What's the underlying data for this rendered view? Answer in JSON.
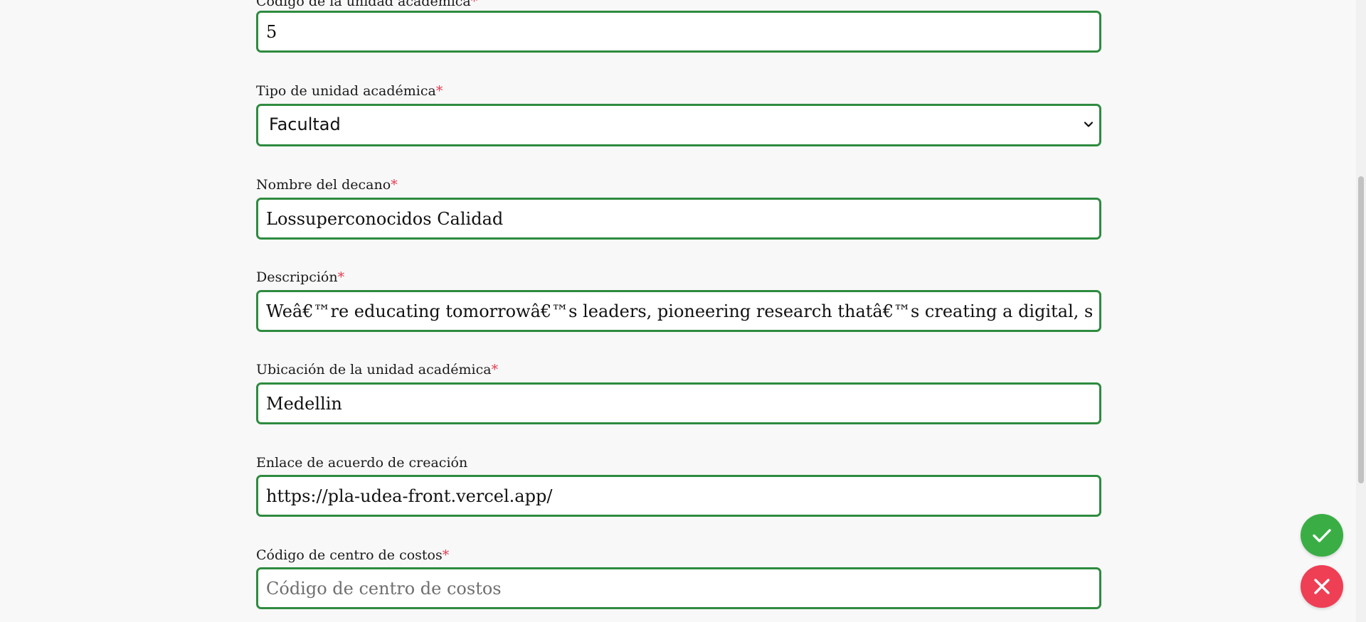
{
  "form": {
    "fields": [
      {
        "label": "Código de la unidad académica",
        "required": true,
        "type": "text",
        "value": "5",
        "placeholder": ""
      },
      {
        "label": "Tipo de unidad académica",
        "required": true,
        "type": "select",
        "value": "Facultad",
        "placeholder": ""
      },
      {
        "label": "Nombre del decano",
        "required": true,
        "type": "text",
        "value": "Lossuperconocidos Calidad",
        "placeholder": ""
      },
      {
        "label": "Descripción",
        "required": true,
        "type": "text",
        "value": "Weâ€™re educating tomorrowâ€™s leaders, pioneering research thatâ€™s creating a digital, sustainable future",
        "placeholder": ""
      },
      {
        "label": "Ubicación de la unidad académica",
        "required": true,
        "type": "text",
        "value": "Medellin",
        "placeholder": ""
      },
      {
        "label": "Enlace de acuerdo de creación",
        "required": false,
        "type": "text",
        "value": "https://pla-udea-front.vercel.app/",
        "placeholder": ""
      },
      {
        "label": "Código de centro de costos",
        "required": true,
        "type": "text",
        "value": "",
        "placeholder": "Código de centro de costos"
      }
    ],
    "required_mark": "*"
  },
  "actions": {
    "confirm_icon": "check-icon",
    "cancel_icon": "close-icon"
  },
  "colors": {
    "field_border": "#2e8b3f",
    "required_mark": "#e53950",
    "confirm_button": "#3aae45",
    "cancel_button": "#ee3f55",
    "page_background": "#f8f8f8"
  }
}
